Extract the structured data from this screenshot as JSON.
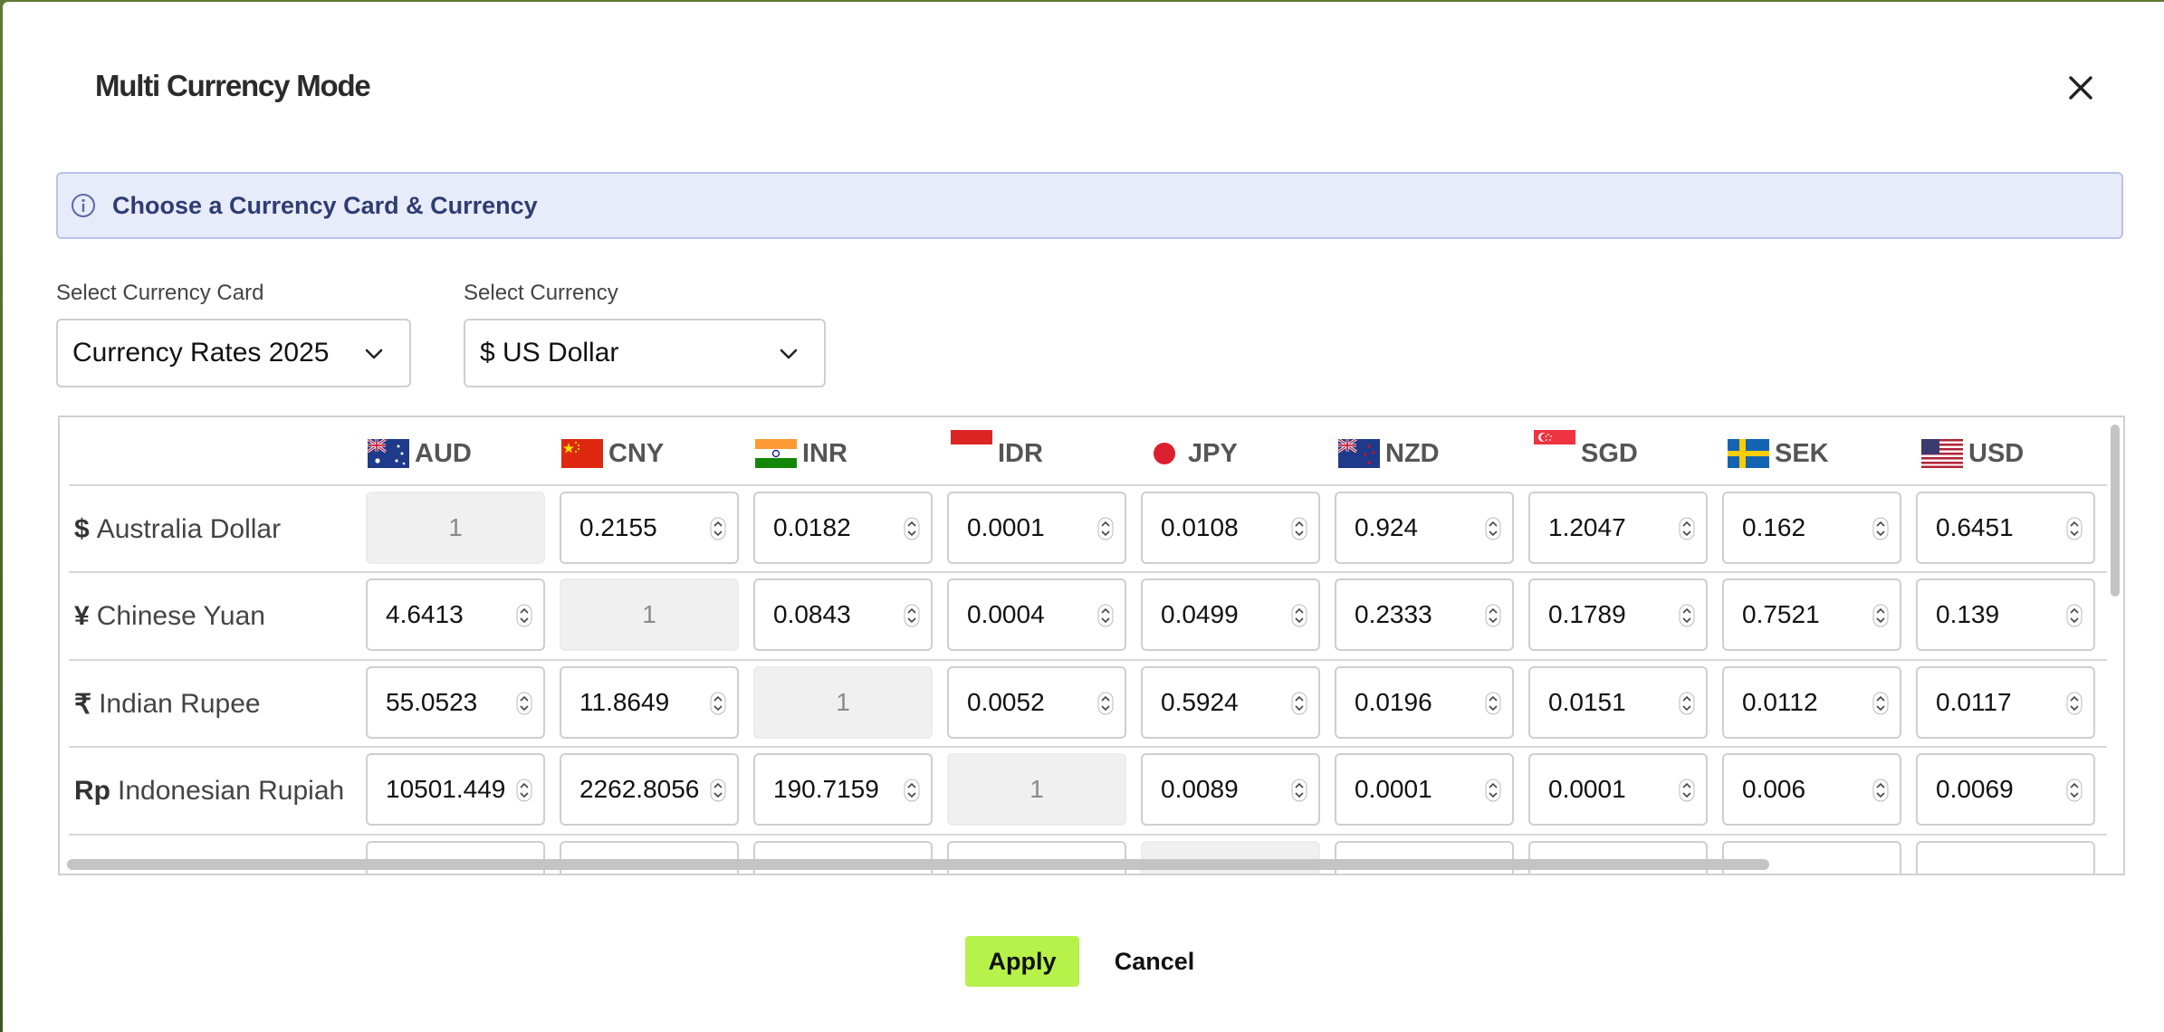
{
  "dialog": {
    "title": "Multi Currency Mode",
    "info": "Choose a Currency Card & Currency"
  },
  "fields": {
    "card_label": "Select Currency Card",
    "card_value": "Currency Rates 2025",
    "currency_label": "Select Currency",
    "currency_value": "$ US Dollar"
  },
  "columns": [
    "AUD",
    "CNY",
    "INR",
    "IDR",
    "JPY",
    "NZD",
    "SGD",
    "SEK",
    "USD"
  ],
  "rows": [
    {
      "symbol": "$",
      "name": "Australia Dollar",
      "values": [
        "1",
        "0.2155",
        "0.0182",
        "0.0001",
        "0.0108",
        "0.924",
        "1.2047",
        "0.162",
        "0.6451"
      ]
    },
    {
      "symbol": "¥",
      "name": "Chinese Yuan",
      "values": [
        "4.6413",
        "1",
        "0.0843",
        "0.0004",
        "0.0499",
        "0.2333",
        "0.1789",
        "0.7521",
        "0.139"
      ]
    },
    {
      "symbol": "₹",
      "name": "Indian Rupee",
      "values": [
        "55.0523",
        "11.8649",
        "1",
        "0.0052",
        "0.5924",
        "0.0196",
        "0.0151",
        "0.0112",
        "0.0117"
      ]
    },
    {
      "symbol": "Rp",
      "name": "Indonesian Rupiah",
      "values": [
        "10501.449",
        "2262.8056",
        "190.7159",
        "1",
        "0.0089",
        "0.0001",
        "0.0001",
        "0.006",
        "0.0069"
      ]
    }
  ],
  "buttons": {
    "apply": "Apply",
    "cancel": "Cancel"
  },
  "colors": {
    "apply_bg": "#b7f24a",
    "info_bg": "#e8ebfa",
    "info_text": "#2e3d73"
  }
}
